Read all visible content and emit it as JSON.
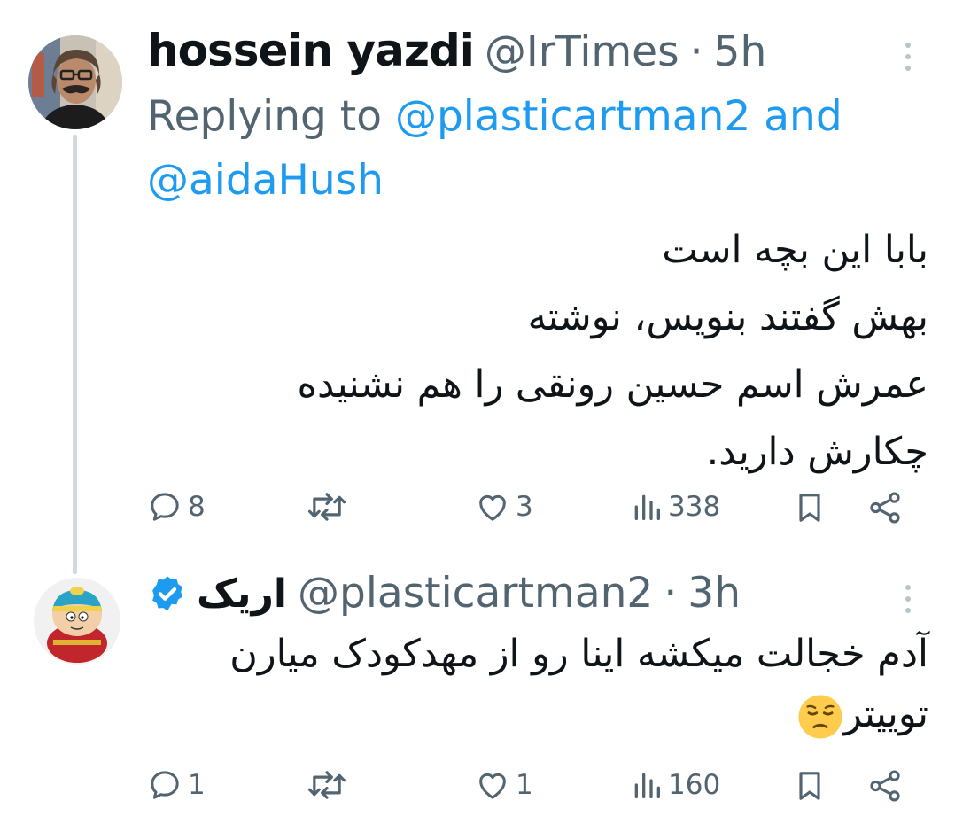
{
  "tweets": [
    {
      "author_name": "hossein yazdi",
      "handle": "@IrTimes",
      "separator": "·",
      "time": "5h",
      "replying_prefix": "Replying to",
      "replying_mention_1": "@plasticartman2",
      "replying_conj": "and",
      "replying_mention_2": "@aidaHush",
      "body_lines": [
        "بابا این بچه است",
        "بهش گفتند بنویس، نوشته",
        "عمرش اسم حسین رونقی را هم نشنیده",
        "چکارش دارید."
      ],
      "stats": {
        "replies": "8",
        "likes": "3",
        "views": "338"
      }
    },
    {
      "author_name": "اریک",
      "verified": true,
      "handle": "@plasticartman2",
      "separator": "·",
      "time": "3h",
      "body_lines": [
        "آدم خجالت میکشه اینا رو از مهدکودک میارن",
        "توییتر"
      ],
      "emoji": "pensive-face",
      "stats": {
        "replies": "1",
        "likes": "1",
        "views": "160"
      }
    }
  ],
  "colors": {
    "text": "#0f1419",
    "secondary": "#536471",
    "link": "#1d9bf0",
    "thread_line": "#cfd9de"
  }
}
